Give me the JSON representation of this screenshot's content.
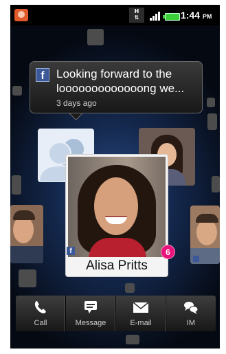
{
  "status_bar": {
    "network_type": "H",
    "time": "1:44",
    "time_suffix": "PM"
  },
  "notification": {
    "source_icon": "facebook-icon",
    "line1": "Looking forward to the",
    "line2": "looooooooooooong we...",
    "time_ago": "3 days ago"
  },
  "contact": {
    "name": "Alisa Pritts",
    "unread_count": "6"
  },
  "actions": [
    {
      "label": "Call",
      "icon": "phone-icon"
    },
    {
      "label": "Message",
      "icon": "message-icon"
    },
    {
      "label": "E-mail",
      "icon": "envelope-icon"
    },
    {
      "label": "IM",
      "icon": "chat-bubbles-icon"
    }
  ]
}
